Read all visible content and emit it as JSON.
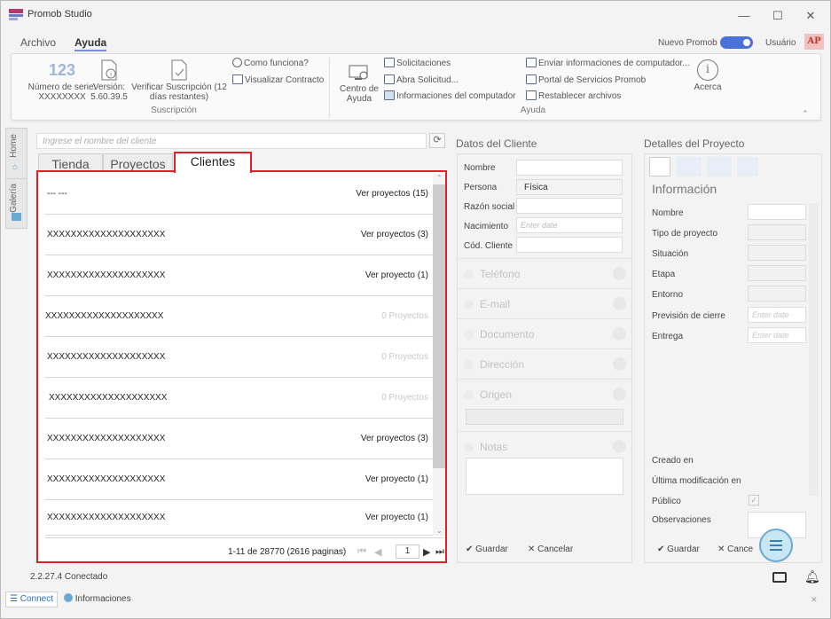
{
  "app": {
    "title": "Promob Studio"
  },
  "menu": {
    "items": [
      "Archivo",
      "Ayuda"
    ],
    "active": "Ayuda",
    "nuevo_promob": "Nuevo Promob",
    "user": "Usuário",
    "avatar": "AP"
  },
  "ribbon": {
    "serial_number": {
      "icon": "123",
      "label_line1": "Número de serie:",
      "label_line2": "XXXXXXXX"
    },
    "version": {
      "label_line1": "Versión:",
      "label_line2": "5.60.39.5"
    },
    "verify_subscription": {
      "label_line1": "Verificar Suscripción (12",
      "label_line2": "días restantes)"
    },
    "how_it_works": "Como funciona?",
    "view_contract": "Visualizar Contracto",
    "group_subscription": "Suscripción",
    "help_center": {
      "label_line1": "Centro de",
      "label_line2": "Ayuda"
    },
    "requests": "Solicitaciones",
    "open_request": "Abra Solicitud...",
    "computer_info": "Informaciones del computador",
    "send_info": "Enviar informaciones de computador...",
    "services_portal": "Portal de Servicios Promob",
    "restore_files": "Restablecer archivos",
    "about": "Acerca",
    "group_help": "Ayuda"
  },
  "sidebar": {
    "tabs": [
      "Home",
      "Galería"
    ]
  },
  "search": {
    "placeholder": "Ingrese el nombre del cliente"
  },
  "tabs": [
    "Tienda",
    "Proyectos",
    "Clientes"
  ],
  "active_tab": "Clientes",
  "clients": [
    {
      "name": "--- ---",
      "link": "Ver proyectos (15)",
      "muted": false
    },
    {
      "name": "XXXXXXXXXXXXXXXXXXXX",
      "link": "Ver proyectos (3)",
      "muted": false
    },
    {
      "name": "XXXXXXXXXXXXXXXXXXXX",
      "link": "Ver proyecto (1)",
      "muted": false
    },
    {
      "name": "XXXXXXXXXXXXXXXXXXXX",
      "link": "0 Proyectos",
      "muted": true
    },
    {
      "name": "XXXXXXXXXXXXXXXXXXXX",
      "link": "0 Proyectos",
      "muted": true
    },
    {
      "name": "XXXXXXXXXXXXXXXXXXXX",
      "link": "0 Proyectos",
      "muted": true
    },
    {
      "name": "XXXXXXXXXXXXXXXXXXXX",
      "link": "Ver proyectos (3)",
      "muted": false
    },
    {
      "name": "XXXXXXXXXXXXXXXXXXXX",
      "link": "Ver proyecto (1)",
      "muted": false
    },
    {
      "name": "XXXXXXXXXXXXXXXXXXXX",
      "link": "Ver proyecto (1)",
      "muted": false
    }
  ],
  "pager": {
    "text": "1-11 de 28770 (2616 paginas)",
    "page": "1"
  },
  "client_data": {
    "title": "Datos del Cliente",
    "fields": [
      "Nombre",
      "Persona",
      "Razón social",
      "Nacimiento",
      "Cód. Cliente"
    ],
    "persona_value": "Física",
    "date_placeholder": "Enter date",
    "sections": [
      "Teléfono",
      "E-mail",
      "Documento",
      "Dirección",
      "Origen",
      "Notas"
    ],
    "save": "Guardar",
    "cancel": "Cancelar"
  },
  "project_details": {
    "title": "Detalles del Proyecto",
    "info": "Información",
    "fields": [
      "Nombre",
      "Tipo de proyecto",
      "Situación",
      "Etapa",
      "Entorno",
      "Previsión de cierre",
      "Entrega"
    ],
    "date_placeholder": "Enter date",
    "meta": [
      "Creado en",
      "Última modificación en",
      "Público",
      "Observaciones"
    ],
    "save": "Guardar",
    "cancel": "Cance"
  },
  "status": {
    "text": "2.2.27.4 Conectado"
  },
  "bottom_tabs": [
    "Connect",
    "Informaciones"
  ]
}
